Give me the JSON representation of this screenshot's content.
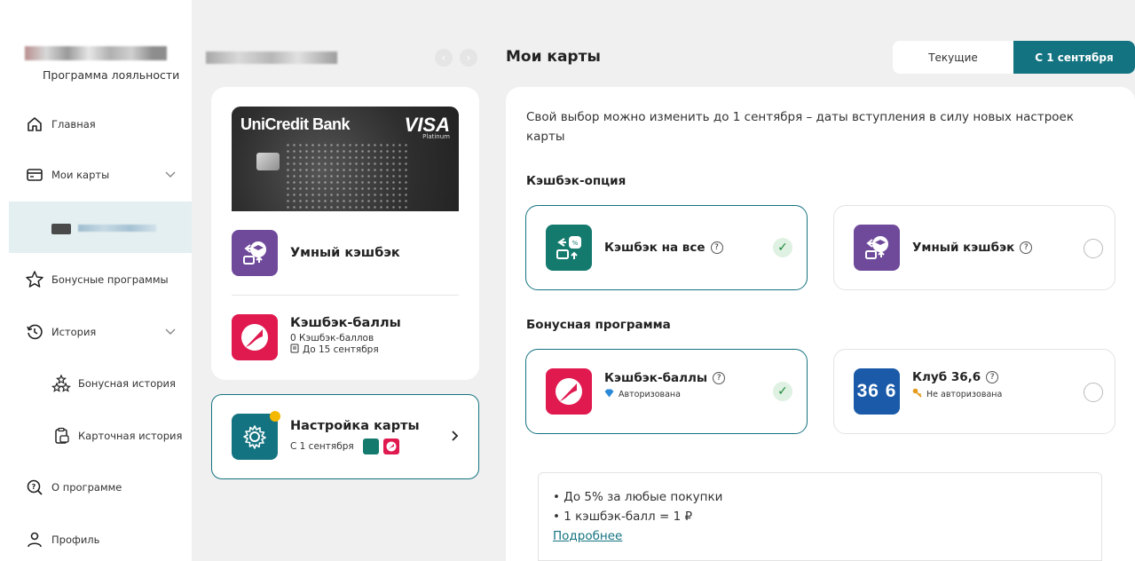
{
  "sidebar": {
    "brand_subtitle": "Программа лояльности",
    "items": [
      {
        "label": "Главная"
      },
      {
        "label": "Мои карты"
      },
      {
        "label": "Бонусные программы"
      },
      {
        "label": "История"
      },
      {
        "label": "Бонусная история"
      },
      {
        "label": "Карточная история"
      },
      {
        "label": "О программе"
      },
      {
        "label": "Профиль"
      }
    ]
  },
  "card": {
    "bank": "UniCredit Bank",
    "network": "VISA",
    "tier": "Platinum"
  },
  "card_options": [
    {
      "title": "Умный кэшбэк"
    },
    {
      "title": "Кэшбэк-баллы",
      "balance": "0 Кэшбэк-баллов",
      "deadline": "До 15 сентября"
    }
  ],
  "card_settings": {
    "title": "Настройка карты",
    "subtitle": "С 1 сентября"
  },
  "main": {
    "title": "Мои карты",
    "tabs": [
      {
        "label": "Текущие",
        "active": false
      },
      {
        "label": "С 1 сентября",
        "active": true
      }
    ],
    "info": "Свой выбор можно изменить до 1 сентября – даты вступления в силу новых настроек карты",
    "cashback_section": "Кэшбэк-опция",
    "cashback_options": [
      {
        "label": "Кэшбэк на все",
        "selected": true
      },
      {
        "label": "Умный кэшбэк",
        "selected": false
      }
    ],
    "bonus_section": "Бонусная программа",
    "bonus_options": [
      {
        "label": "Кэшбэк-баллы",
        "status": "Авторизована",
        "selected": true
      },
      {
        "label": "Клуб 36,6",
        "status": "Не авторизована",
        "selected": false,
        "logo_text": "36 6"
      }
    ],
    "details": {
      "bullets": [
        "До 5% за любые покупки",
        "1 кэшбэк-балл = 1 ₽"
      ],
      "link": "Подробнее"
    }
  },
  "colors": {
    "accent": "#147380",
    "purple": "#6f4a9b",
    "green": "#157a6e",
    "red": "#e0194f",
    "blue": "#1a5aa8"
  }
}
